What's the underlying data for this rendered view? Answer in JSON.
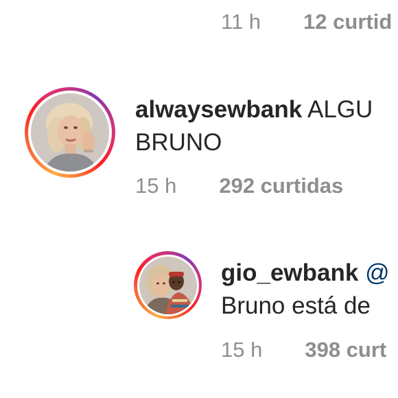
{
  "comments": [
    {
      "time": "11 h",
      "likes": "12 curtid"
    },
    {
      "username": "alwaysewbank",
      "text_line1": "ALGU",
      "text_line2": "BRUNO",
      "time": "15 h",
      "likes": "292 curtidas",
      "avatar_icon": "profile-photo-icon"
    },
    {
      "username": "gio_ewbank",
      "mention": "@",
      "text_line2": "Bruno está de",
      "time": "15 h",
      "likes": "398 curt",
      "avatar_icon": "profile-photo-icon"
    }
  ],
  "colors": {
    "text": "#262626",
    "meta": "#8e8e8e",
    "mention": "#00376b",
    "story_ring": [
      "#fcaf45",
      "#f77737",
      "#fd1d1d",
      "#e1306c",
      "#c13584",
      "#833ab4"
    ]
  }
}
